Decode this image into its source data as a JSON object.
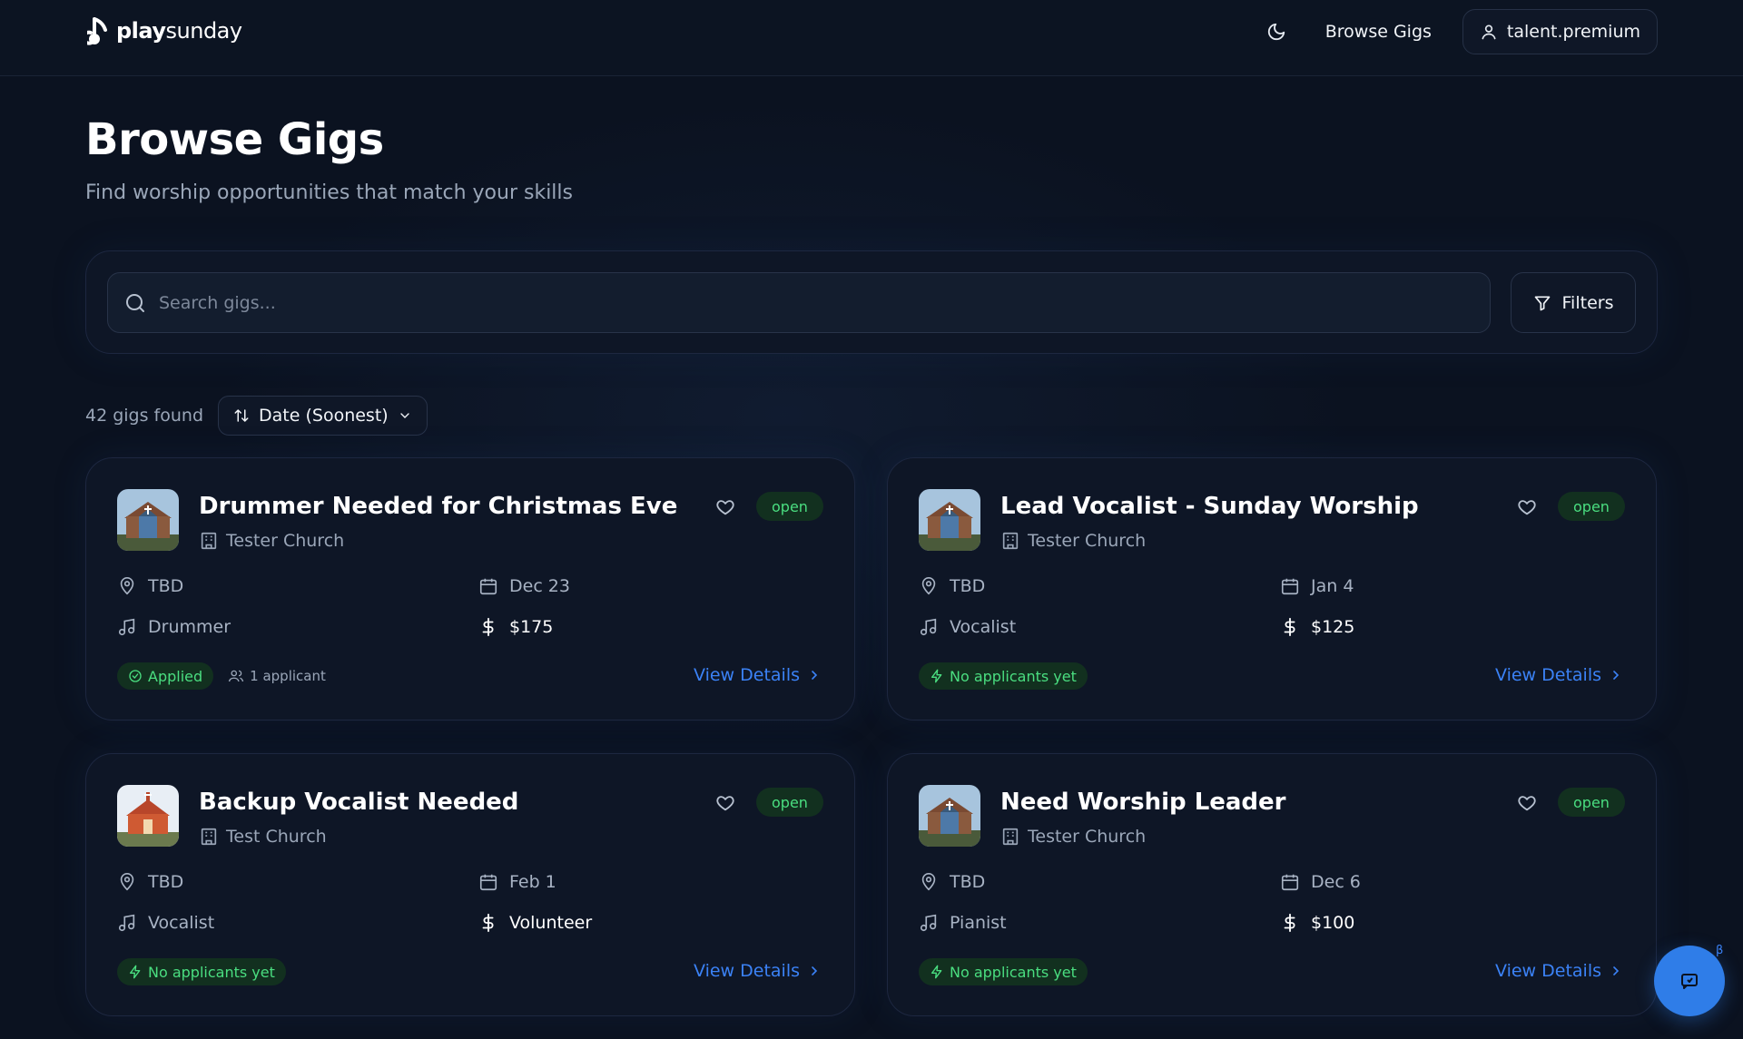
{
  "app": {
    "logo_bold": "play",
    "logo_light": "sunday"
  },
  "nav": {
    "browse_label": "Browse Gigs",
    "user_label": "talent.premium"
  },
  "page": {
    "title": "Browse Gigs",
    "subtitle": "Find worship opportunities that match your skills"
  },
  "search": {
    "placeholder": "Search gigs...",
    "filters_label": "Filters"
  },
  "results": {
    "count_text": "42 gigs found",
    "sort_label": "Date (Soonest)"
  },
  "cards": [
    {
      "title": "Drummer Needed for Christmas Eve",
      "org": "Tester Church",
      "status": "open",
      "location": "TBD",
      "date": "Dec 23",
      "role": "Drummer",
      "pay": "$175",
      "pay_amount": "$175",
      "applied_label": "Applied",
      "applicants_label": "1 applicant",
      "view_label": "View Details"
    },
    {
      "title": "Lead Vocalist - Sunday Worship",
      "org": "Tester Church",
      "status": "open",
      "location": "TBD",
      "date": "Jan 4",
      "role": "Vocalist",
      "pay": "$125",
      "pay_amount": "$125",
      "applicants_label": "No applicants yet",
      "view_label": "View Details"
    },
    {
      "title": "Backup Vocalist Needed",
      "org": "Test Church",
      "status": "open",
      "location": "TBD",
      "date": "Feb 1",
      "role": "Vocalist",
      "pay": "Volunteer",
      "pay_amount": "Volunteer",
      "applicants_label": "No applicants yet",
      "view_label": "View Details"
    },
    {
      "title": "Need Worship Leader",
      "org": "Tester Church",
      "status": "open",
      "location": "TBD",
      "date": "Dec 6",
      "role": "Pianist",
      "pay": "$100",
      "pay_amount": "$100",
      "applicants_label": "No applicants yet",
      "view_label": "View Details"
    }
  ],
  "chat": {
    "beta_label": "β"
  },
  "colors": {
    "background": "#0b1220",
    "accent_blue": "#3b82f6",
    "status_green": "#4ade80",
    "card_bg": "#0e1626"
  }
}
